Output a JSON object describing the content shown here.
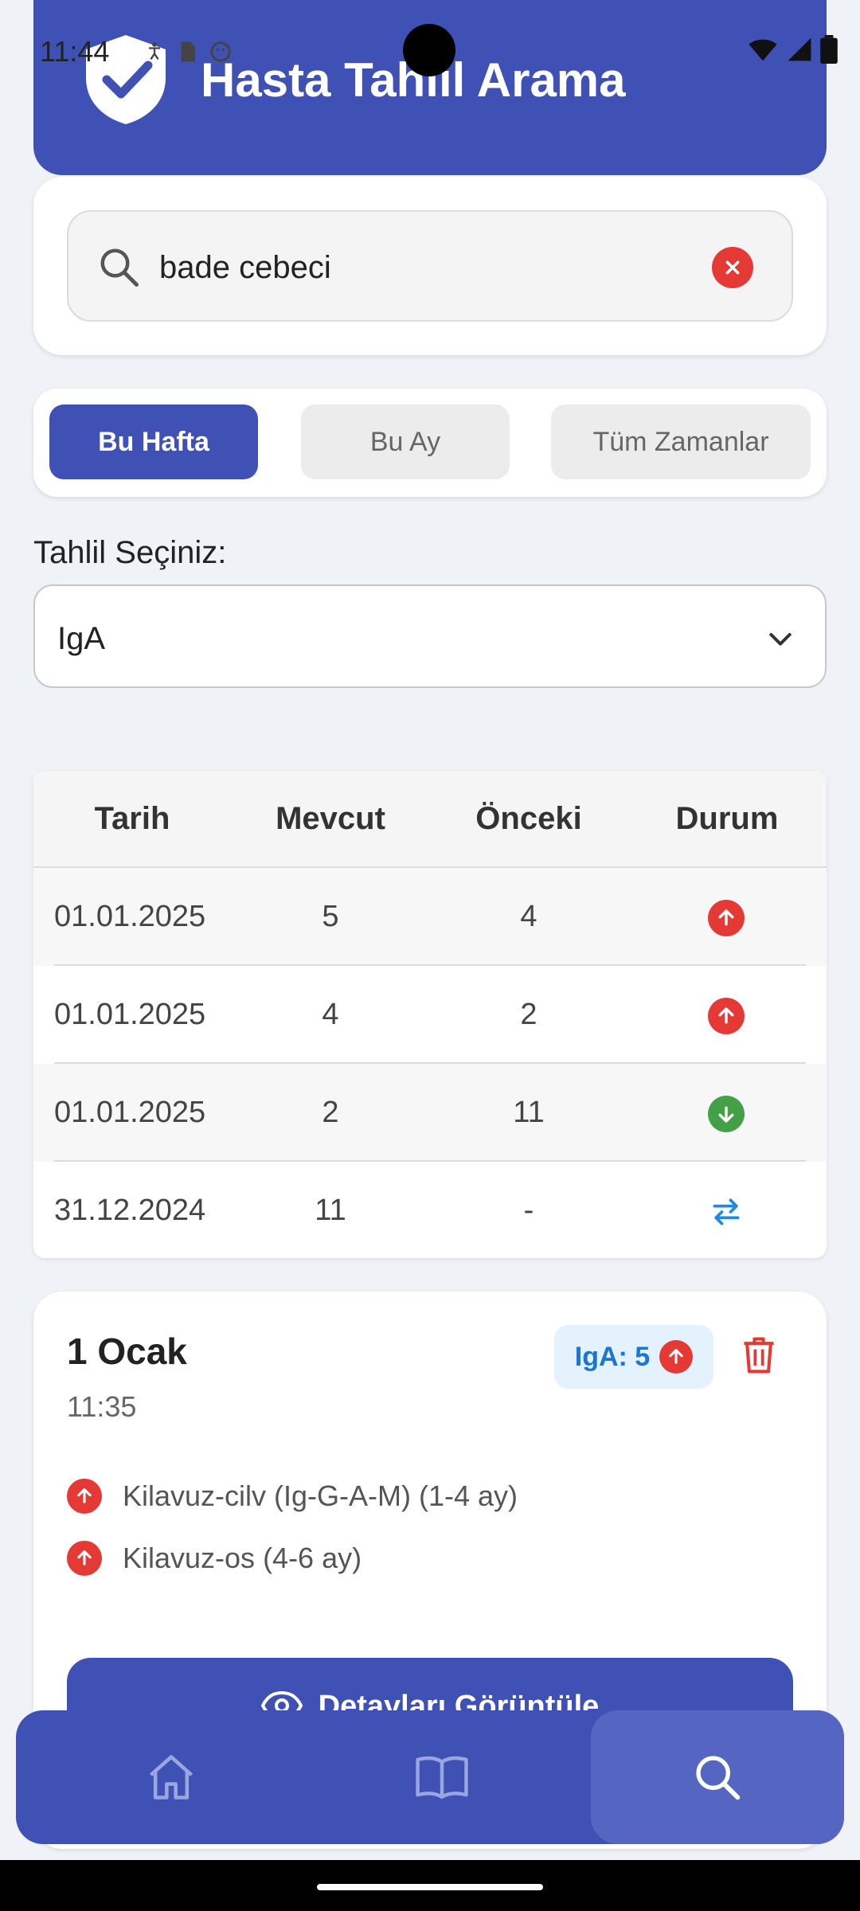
{
  "status_bar": {
    "time": "11:44"
  },
  "header": {
    "title": "Hasta Tahlil Arama"
  },
  "search": {
    "value": "bade cebeci"
  },
  "period_tabs": [
    {
      "label": "Bu Hafta",
      "active": true
    },
    {
      "label": "Bu Ay",
      "active": false
    },
    {
      "label": "Tüm Zamanlar",
      "active": false
    }
  ],
  "test_select": {
    "label": "Tahlil Seçiniz:",
    "value": "IgA"
  },
  "table": {
    "headers": [
      "Tarih",
      "Mevcut",
      "Önceki",
      "Durum"
    ],
    "rows": [
      {
        "date": "01.01.2025",
        "current": "5",
        "previous": "4",
        "status": "up"
      },
      {
        "date": "01.01.2025",
        "current": "4",
        "previous": "2",
        "status": "up"
      },
      {
        "date": "01.01.2025",
        "current": "2",
        "previous": "11",
        "status": "down"
      },
      {
        "date": "31.12.2024",
        "current": "11",
        "previous": "-",
        "status": "swap"
      }
    ]
  },
  "result_card": {
    "title": "1 Ocak",
    "time": "11:35",
    "badge": "IgA: 5",
    "items": [
      {
        "text": "Kilavuz-cilv (Ig-G-A-M) (1-4 ay)",
        "status": "up"
      },
      {
        "text": "Kilavuz-os (4-6 ay)",
        "status": "up"
      }
    ],
    "details_button": "Detayları Görüntüle"
  },
  "colors": {
    "primary": "#3f51b5",
    "up": "#e53935",
    "down": "#43a047",
    "swap": "#1e88e5"
  },
  "bottom_nav": [
    {
      "icon": "home-icon",
      "active": false
    },
    {
      "icon": "book-icon",
      "active": false
    },
    {
      "icon": "search-icon",
      "active": true
    }
  ]
}
